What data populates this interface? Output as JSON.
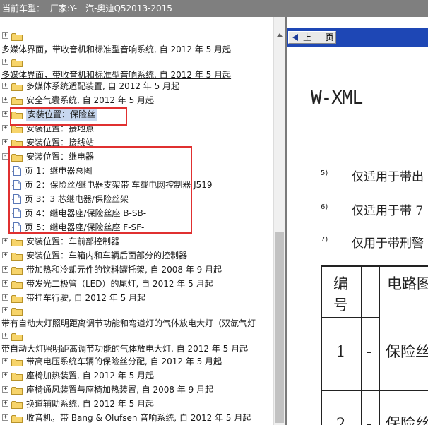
{
  "header": {
    "label": "当前车型：",
    "value": "厂家:Y-一汽-奥迪Q52013-2015"
  },
  "tree": {
    "top_line_1": "多媒体界面，带收音机和标准型音响系统, 自 2012 年 5 月起",
    "top_line_2": "多媒体界面，带收音机和标准型音响系统, 自 2012 年 5 月起",
    "items": [
      "多媒体系统适配装置, 自 2012 年 5 月起",
      "安全气囊系统, 自 2012 年 5 月起",
      "安装位置：保险丝",
      "安装位置：接地点",
      "安装位置：接线站",
      "安装位置：继电器"
    ],
    "relay_children": [
      "页 1：继电器总图",
      "页 2：保险丝/继电器支架带 车载电网控制器 J519",
      "页 3：3 芯继电器/保险丝架",
      "页 4：继电器座/保险丝座 B-SB-",
      "页 5：继电器座/保险丝座 F-SF-"
    ],
    "items_after": [
      "安装位置：车前部控制器",
      "安装位置：车箱内和车辆后面部分的控制器",
      "带加热和冷却元件的饮料罐托架, 自 2008 年 9 月起",
      "带发光二极管（LED）的尾灯, 自 2012 年 5 月起",
      "带挂车行驶, 自 2012 年 5 月起"
    ],
    "wrap_line_1": "带有自动大灯照明距离调节功能和弯道灯的气体放电大灯（双氙气灯",
    "wrap_line_2": "带自动大灯照明距离调节功能的气体放电大灯, 自 2012 年 5 月起",
    "items_last": [
      "带高电压系统车辆的保险丝分配, 自 2012 年 5 月起",
      "座椅加热装置, 自 2012 年 5 月起",
      "座椅通风装置与座椅加热装置, 自 2008 年 9 月起",
      "换道辅助系统, 自 2012 年 5 月起",
      "收音机，带 Bang & Olufsen 音响系统, 自 2012 年 5 月起"
    ]
  },
  "doc": {
    "prev_label": "上 一 页",
    "heading": "W-XML",
    "notes": [
      {
        "num": "5)",
        "text": "仅适用于带出"
      },
      {
        "num": "6)",
        "text": "仅适用于带 7"
      },
      {
        "num": "7)",
        "text": "仅用于带刑警"
      }
    ],
    "table": {
      "header_1": "编",
      "header_1b": "号",
      "header_2": "电路图",
      "rows": [
        {
          "num": "1",
          "dash": "-",
          "text": "保险丝"
        },
        {
          "num": "2",
          "dash": "-",
          "text": "保险丝"
        }
      ]
    }
  },
  "colors": {
    "header_bg": "#7f7f7f",
    "toolbar_bg": "#1e47b5",
    "highlight": "#c7d7ef",
    "red_box": "#e03030"
  }
}
